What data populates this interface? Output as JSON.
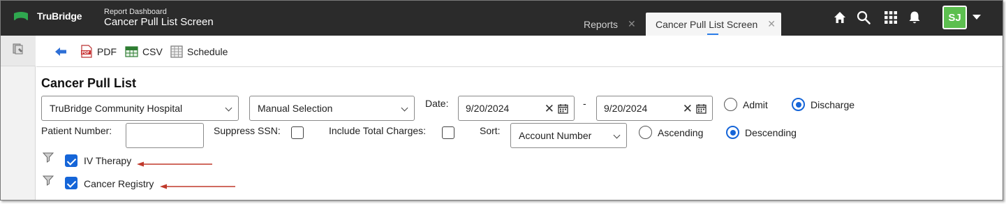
{
  "app": {
    "logo_text": "TruBridge",
    "report_subtitle": "Report Dashboard",
    "report_title": "Cancer Pull List Screen"
  },
  "tabs": [
    {
      "label": "Reports",
      "close": "✕",
      "active": false
    },
    {
      "label": "Cancer Pull List Screen",
      "close": "✕",
      "active": true
    }
  ],
  "header_icons": [
    "home-icon",
    "search-icon",
    "apps-grid-icon",
    "notification-bell-icon"
  ],
  "user": {
    "initials": "SJ"
  },
  "toolbar": {
    "back_icon": "back-arrow-icon",
    "pdf_label": "PDF",
    "csv_label": "CSV",
    "schedule_label": "Schedule"
  },
  "form": {
    "heading": "Cancer Pull List",
    "facility": {
      "value": "TruBridge Community Hospital"
    },
    "selection": {
      "value": "Manual Selection"
    },
    "date_label": "Date:",
    "date_from": "9/20/2024",
    "date_separator": "-",
    "date_to": "9/20/2024",
    "date_type_options": [
      {
        "label": "Admit",
        "selected": false
      },
      {
        "label": "Discharge",
        "selected": true
      }
    ],
    "patient_number_label": "Patient Number:",
    "patient_number_value": "",
    "suppress_ssn_label": "Suppress SSN:",
    "suppress_ssn_checked": false,
    "include_total_charges_label": "Include Total Charges:",
    "include_total_charges_checked": false,
    "sort_label": "Sort:",
    "sort_value": "Account Number",
    "sort_order_options": [
      {
        "label": "Ascending",
        "selected": false
      },
      {
        "label": "Descending",
        "selected": true
      }
    ],
    "filters": [
      {
        "label": "IV Therapy",
        "checked": true
      },
      {
        "label": "Cancer Registry",
        "checked": true
      }
    ]
  },
  "colors": {
    "topbar_bg": "#2b2b2b",
    "accent_blue": "#1565d8",
    "avatar_green": "#5cbf4f",
    "annotation_arrow": "#c0392b"
  }
}
